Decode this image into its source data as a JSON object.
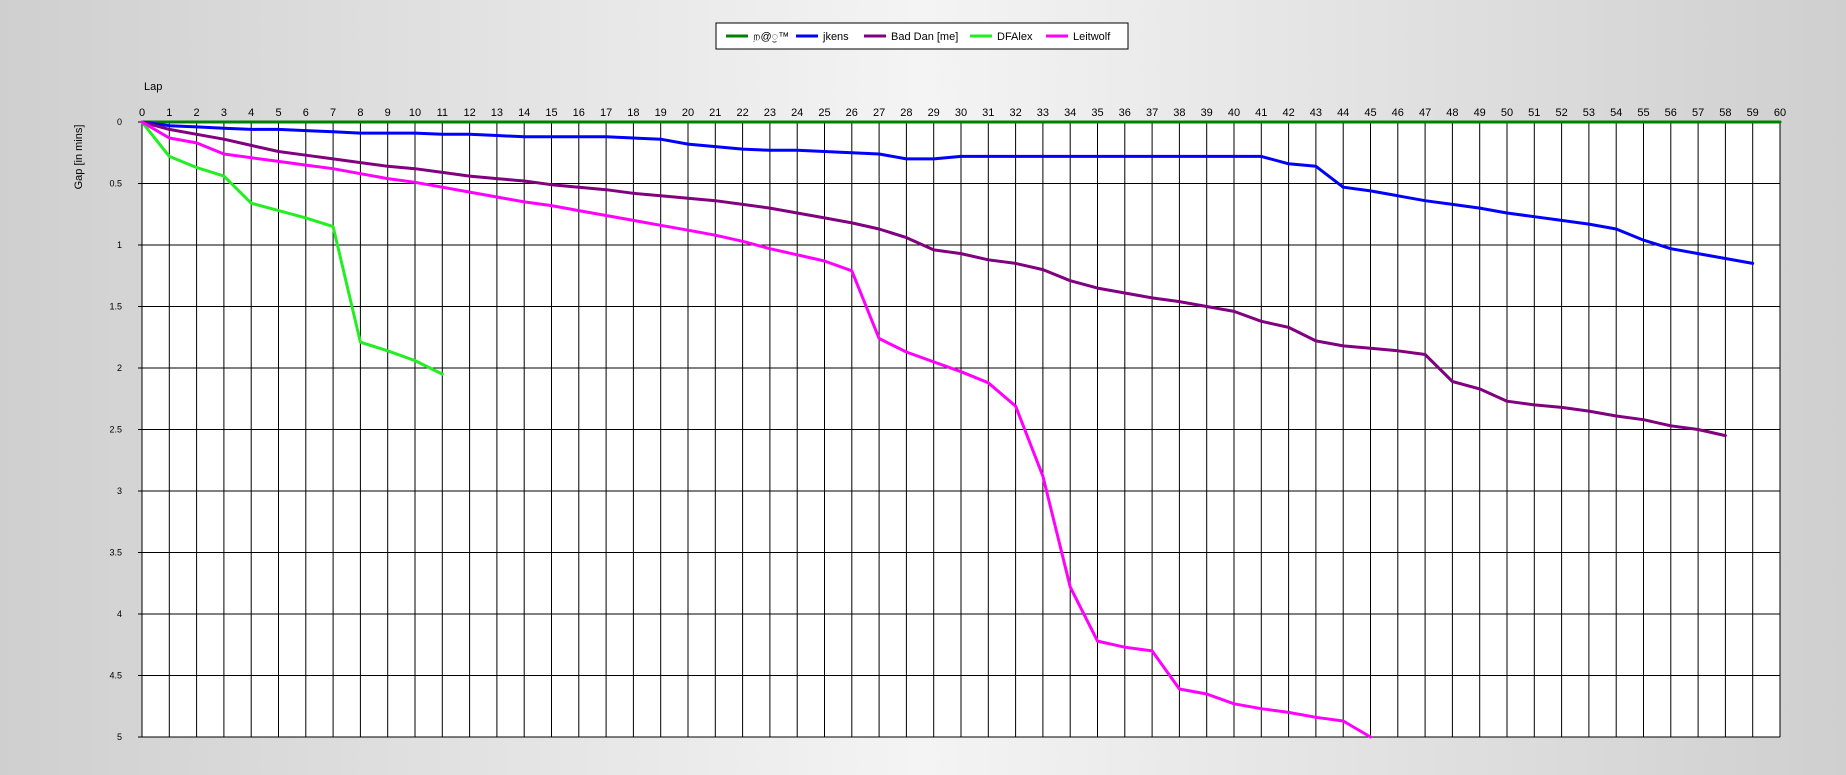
{
  "chart_data": {
    "type": "line",
    "title": "",
    "xlabel": "Lap",
    "ylabel": "Gap [in mins]",
    "xlim": [
      0,
      60
    ],
    "ylim": [
      0,
      5
    ],
    "y_inverted": true,
    "grid": true,
    "legend_position": "top-center",
    "x_ticks": [
      0,
      1,
      2,
      3,
      4,
      5,
      6,
      7,
      8,
      9,
      10,
      11,
      12,
      13,
      14,
      15,
      16,
      17,
      18,
      19,
      20,
      21,
      22,
      23,
      24,
      25,
      26,
      27,
      28,
      29,
      30,
      31,
      32,
      33,
      34,
      35,
      36,
      37,
      38,
      39,
      40,
      41,
      42,
      43,
      44,
      45,
      46,
      47,
      48,
      49,
      50,
      51,
      52,
      53,
      54,
      55,
      56,
      57,
      58,
      59,
      60
    ],
    "y_ticks": [
      {
        "value": 0,
        "label": "0"
      },
      {
        "value": 0.5,
        "label": "0.5"
      },
      {
        "value": 1,
        "label": "1"
      },
      {
        "value": 1.5,
        "label": "1.5"
      },
      {
        "value": 2,
        "label": "2"
      },
      {
        "value": 2.5,
        "label": "2.5"
      },
      {
        "value": 3,
        "label": "3"
      },
      {
        "value": 3.5,
        "label": "3.5"
      },
      {
        "value": 4,
        "label": "4"
      },
      {
        "value": 4.5,
        "label": "4.5"
      },
      {
        "value": 5,
        "label": "5"
      }
    ],
    "series": [
      {
        "name": "ற@ॖ™",
        "color": "#008000",
        "x": [
          0,
          60
        ],
        "y": [
          0,
          0
        ]
      },
      {
        "name": "jkens",
        "color": "#0000ff",
        "x": [
          0,
          1,
          2,
          3,
          4,
          5,
          6,
          7,
          8,
          9,
          10,
          11,
          12,
          13,
          14,
          15,
          16,
          17,
          18,
          19,
          20,
          21,
          22,
          23,
          24,
          25,
          26,
          27,
          28,
          29,
          30,
          31,
          32,
          33,
          34,
          35,
          36,
          37,
          38,
          39,
          40,
          41,
          42,
          43,
          44,
          45,
          46,
          47,
          48,
          49,
          50,
          51,
          52,
          53,
          54,
          55,
          56,
          57,
          58,
          59
        ],
        "y": [
          0,
          0.03,
          0.04,
          0.05,
          0.06,
          0.06,
          0.07,
          0.08,
          0.09,
          0.09,
          0.09,
          0.1,
          0.1,
          0.11,
          0.12,
          0.12,
          0.12,
          0.12,
          0.13,
          0.14,
          0.18,
          0.2,
          0.22,
          0.23,
          0.23,
          0.24,
          0.25,
          0.26,
          0.3,
          0.3,
          0.28,
          0.28,
          0.28,
          0.28,
          0.28,
          0.28,
          0.28,
          0.28,
          0.28,
          0.28,
          0.28,
          0.28,
          0.34,
          0.36,
          0.53,
          0.56,
          0.6,
          0.64,
          0.67,
          0.7,
          0.74,
          0.77,
          0.8,
          0.83,
          0.87,
          0.96,
          1.03,
          1.07,
          1.11,
          1.15
        ]
      },
      {
        "name": "Bad Dan [me]",
        "color": "#800080",
        "x": [
          0,
          1,
          2,
          3,
          4,
          5,
          6,
          7,
          8,
          9,
          10,
          11,
          12,
          13,
          14,
          15,
          16,
          17,
          18,
          19,
          20,
          21,
          22,
          23,
          24,
          25,
          26,
          27,
          28,
          29,
          30,
          31,
          32,
          33,
          34,
          35,
          36,
          37,
          38,
          39,
          40,
          41,
          42,
          43,
          44,
          45,
          46,
          47,
          48,
          49,
          50,
          51,
          52,
          53,
          54,
          55,
          56,
          57,
          58
        ],
        "y": [
          0,
          0.06,
          0.1,
          0.14,
          0.19,
          0.24,
          0.27,
          0.3,
          0.33,
          0.36,
          0.38,
          0.41,
          0.44,
          0.46,
          0.48,
          0.51,
          0.53,
          0.55,
          0.58,
          0.6,
          0.62,
          0.64,
          0.67,
          0.7,
          0.74,
          0.78,
          0.82,
          0.87,
          0.94,
          1.04,
          1.07,
          1.12,
          1.15,
          1.2,
          1.29,
          1.35,
          1.39,
          1.43,
          1.46,
          1.5,
          1.54,
          1.62,
          1.67,
          1.78,
          1.82,
          1.84,
          1.86,
          1.89,
          2.11,
          2.17,
          2.27,
          2.3,
          2.32,
          2.35,
          2.39,
          2.42,
          2.47,
          2.5,
          2.55
        ]
      },
      {
        "name": "DFAlex",
        "color": "#22ee22",
        "x": [
          0,
          1,
          2,
          3,
          4,
          5,
          6,
          7,
          8,
          9,
          10,
          11
        ],
        "y": [
          0,
          0.28,
          0.37,
          0.44,
          0.66,
          0.72,
          0.78,
          0.85,
          1.79,
          1.86,
          1.94,
          2.05
        ]
      },
      {
        "name": "Leitwolf",
        "color": "#ff00ff",
        "x": [
          0,
          1,
          2,
          3,
          4,
          5,
          6,
          7,
          8,
          9,
          10,
          11,
          12,
          13,
          14,
          15,
          16,
          17,
          18,
          19,
          20,
          21,
          22,
          23,
          24,
          25,
          26,
          27,
          28,
          29,
          30,
          31,
          32,
          33,
          34,
          35,
          36,
          37,
          38,
          39,
          40,
          41,
          42,
          43,
          44,
          45
        ],
        "y": [
          0,
          0.13,
          0.17,
          0.26,
          0.29,
          0.32,
          0.35,
          0.38,
          0.42,
          0.46,
          0.49,
          0.53,
          0.57,
          0.61,
          0.65,
          0.68,
          0.72,
          0.76,
          0.8,
          0.84,
          0.88,
          0.92,
          0.97,
          1.03,
          1.08,
          1.13,
          1.21,
          1.76,
          1.87,
          1.95,
          2.03,
          2.12,
          2.31,
          2.88,
          3.78,
          4.22,
          4.27,
          4.3,
          4.61,
          4.65,
          4.73,
          4.77,
          4.8,
          4.84,
          4.87,
          5
        ]
      }
    ]
  }
}
